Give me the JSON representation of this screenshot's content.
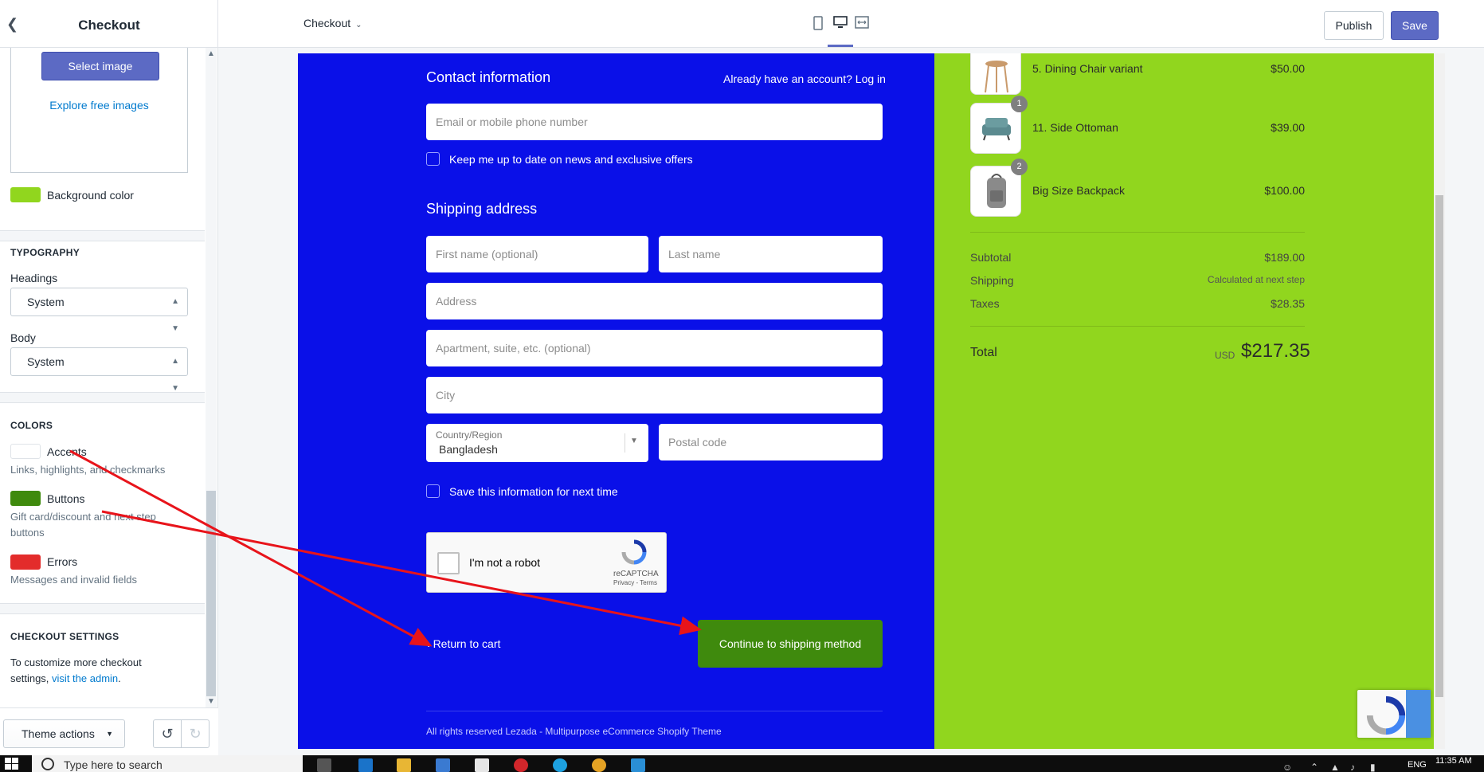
{
  "sidebar": {
    "title": "Checkout",
    "image": {
      "select_label": "Select image",
      "explore_label": "Explore free images"
    },
    "background_color_label": "Background color",
    "typography": {
      "section_title": "TYPOGRAPHY",
      "headings_label": "Headings",
      "headings_value": "System",
      "body_label": "Body",
      "body_value": "System"
    },
    "colors": {
      "section_title": "COLORS",
      "accents_label": "Accents",
      "accents_help": "Links, highlights, and checkmarks",
      "accents_color": "#ffffff",
      "buttons_label": "Buttons",
      "buttons_help_1": "Gift card/discount and next step",
      "buttons_help_2": "buttons",
      "buttons_color": "#3f8a0d",
      "errors_label": "Errors",
      "errors_help": "Messages and invalid fields",
      "errors_color": "#e32c2b",
      "background_color": "#91d61e"
    },
    "checkout_settings": {
      "section_title": "CHECKOUT SETTINGS",
      "text_1": "To customize more checkout",
      "text_2": "settings,",
      "link": "visit the admin",
      "text_end": "."
    },
    "footer": {
      "theme_actions_label": "Theme actions"
    }
  },
  "topbar": {
    "page_select": "Checkout",
    "publish_label": "Publish",
    "save_label": "Save"
  },
  "checkout": {
    "contact_title": "Contact information",
    "account_prompt": "Already have an account?",
    "login_link": "Log in",
    "email_placeholder": "Email or mobile phone number",
    "newsletter_label": "Keep me up to date on news and exclusive offers",
    "shipping_title": "Shipping address",
    "first_name_placeholder": "First name (optional)",
    "last_name_placeholder": "Last name",
    "address_placeholder": "Address",
    "apartment_placeholder": "Apartment, suite, etc. (optional)",
    "city_placeholder": "City",
    "country_label": "Country/Region",
    "country_value": "Bangladesh",
    "postal_placeholder": "Postal code",
    "save_info_label": "Save this information for next time",
    "recaptcha_text": "I'm not a robot",
    "recaptcha_brand": "reCAPTCHA",
    "recaptcha_terms": "Privacy - Terms",
    "return_label": "Return to cart",
    "continue_label": "Continue to shipping method",
    "footer_text": "All rights reserved Lezada - Multipurpose eCommerce Shopify Theme",
    "main_background": "#0a10e8"
  },
  "summary": {
    "items": [
      {
        "name": "5. Dining Chair variant",
        "price": "$50.00",
        "qty": ""
      },
      {
        "name": "11. Side Ottoman",
        "price": "$39.00",
        "qty": "1"
      },
      {
        "name": "Big Size Backpack",
        "price": "$100.00",
        "qty": "2"
      }
    ],
    "subtotal_label": "Subtotal",
    "subtotal_value": "$189.00",
    "shipping_label": "Shipping",
    "shipping_value": "Calculated at next step",
    "taxes_label": "Taxes",
    "taxes_value": "$28.35",
    "total_label": "Total",
    "total_currency": "USD",
    "total_value": "$217.35"
  },
  "taskbar": {
    "search_placeholder": "Type here to search",
    "language": "ENG",
    "time": "11:35 AM"
  }
}
